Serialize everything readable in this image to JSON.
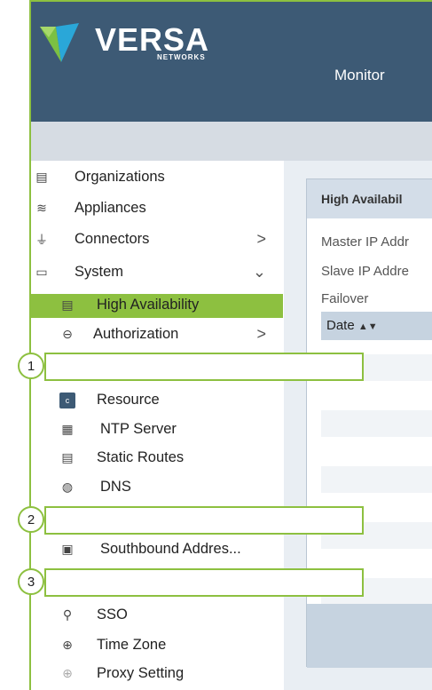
{
  "brand": {
    "name": "VERSA",
    "sub": "NETWORKS"
  },
  "header": {
    "monitor_tab": "Monitor"
  },
  "sidebar": {
    "organizations": "Organizations",
    "appliances": "Appliances",
    "connectors": "Connectors",
    "system": "System",
    "high_availability": "High Availability",
    "authorization": "Authorization",
    "resource": "Resource",
    "ntp_server": "NTP Server",
    "static_routes": "Static Routes",
    "dns": "DNS",
    "southbound": "Southbound Addres...",
    "sso": "SSO",
    "time_zone": "Time Zone",
    "proxy_setting": "Proxy Setting"
  },
  "panel": {
    "title": "High Availabil",
    "master_ip": "Master IP Addr",
    "slave_ip": "Slave IP Addre",
    "failover": "Failover",
    "date_column": "Date"
  },
  "callouts": [
    "1",
    "2",
    "3"
  ],
  "colors": {
    "accent": "#8dc040",
    "header_bg": "#3d5a75"
  }
}
